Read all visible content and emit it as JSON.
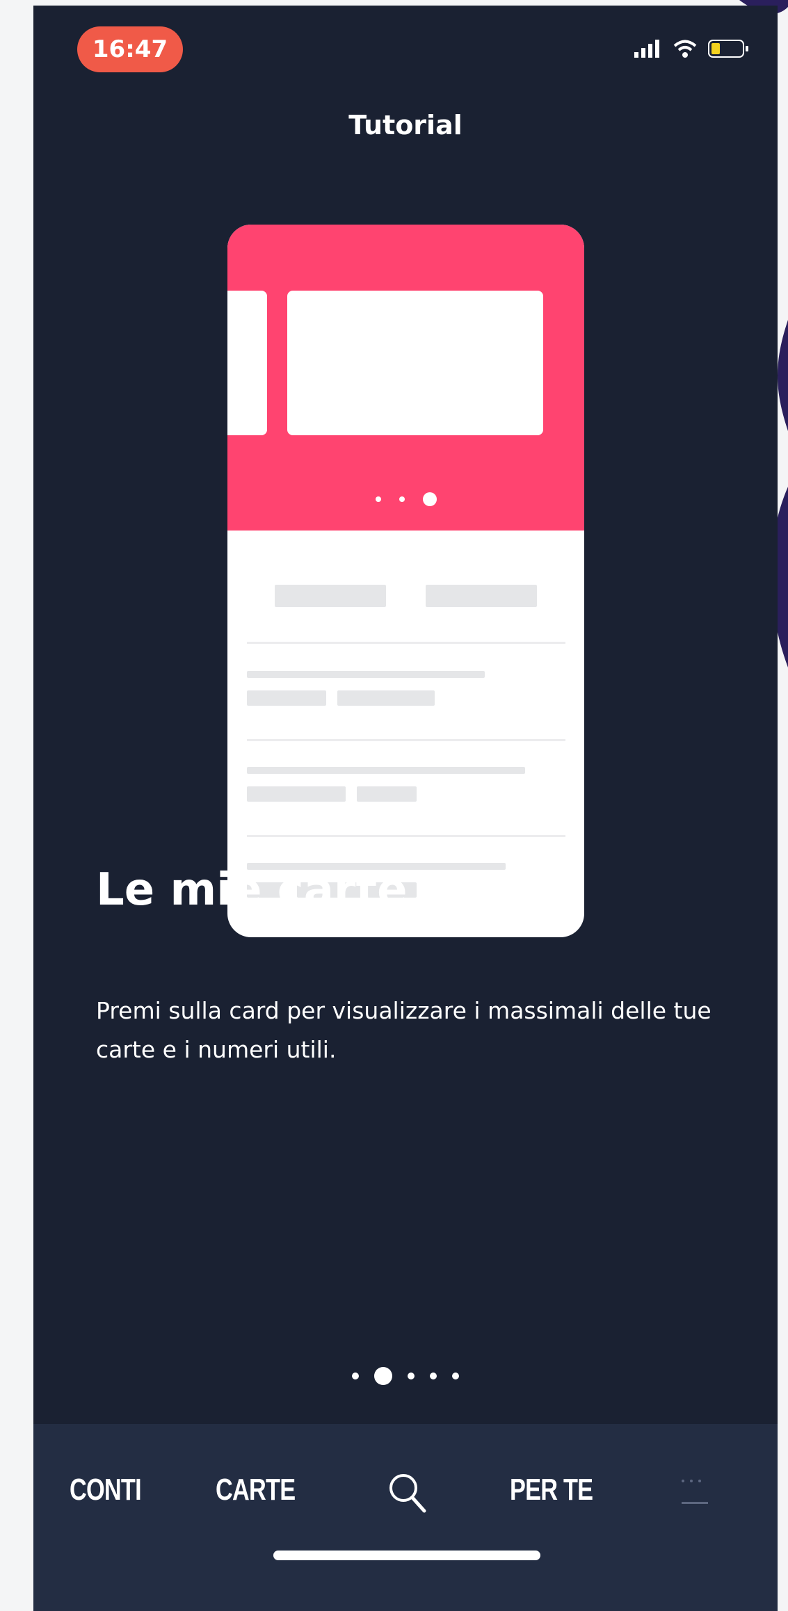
{
  "status_bar": {
    "time": "16:47",
    "signal_icon": "signal-icon",
    "wifi_icon": "wifi-icon",
    "battery_icon": "battery-icon"
  },
  "nav": {
    "title": "Tutorial"
  },
  "slide": {
    "title": "Le mie carte",
    "description": "Premi sulla card per visualizzare i massimali delle tue carte e i numeri utili.",
    "illustration_icon": "phone-cards-illustration"
  },
  "pager": {
    "total": 5,
    "current": 2
  },
  "tabbar": {
    "tabs": [
      {
        "label": "CONTI"
      },
      {
        "label": "CARTE"
      },
      {
        "label": "",
        "icon": "search-icon"
      },
      {
        "label": "PER TE"
      },
      {
        "label": "",
        "icon": "more-icon"
      }
    ]
  },
  "colors": {
    "background": "#1a2132",
    "tabbar": "#232d43",
    "accent": "#ff4470",
    "time_pill": "#f05a48"
  }
}
